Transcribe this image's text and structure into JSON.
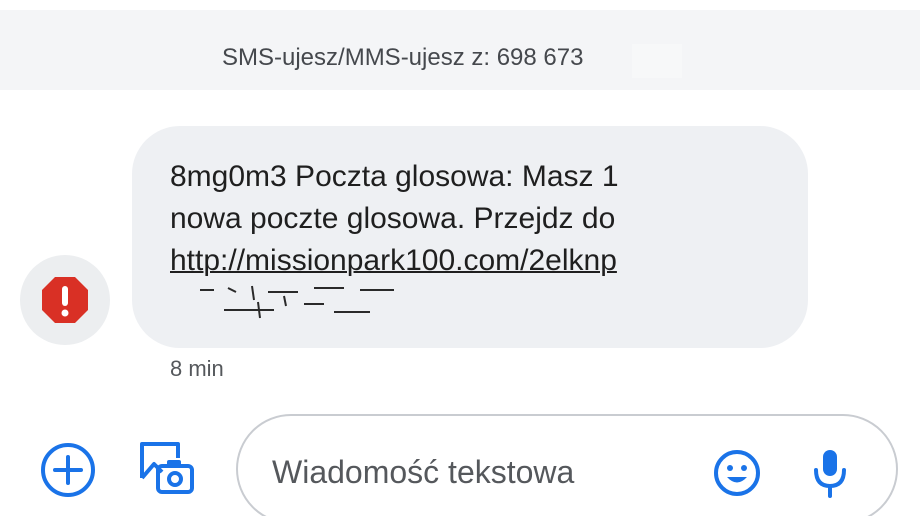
{
  "header": {
    "sender_line": "SMS-ujesz/MMS-ujesz z: 698 673"
  },
  "message": {
    "text": "8mg0m3 Poczta glosowa: Masz 1\nnowa poczte glosowa. Przejdz do",
    "link": "http://missionpark100.com/2elknp",
    "timestamp": "8 min"
  },
  "compose": {
    "placeholder": "Wiadomość tekstowa"
  },
  "colors": {
    "accent": "#1a73e8",
    "alert": "#d93025",
    "bubble": "#eef0f3",
    "banner": "#f4f5f7"
  },
  "icons": {
    "alert": "exclamation-octagon-icon",
    "add": "plus-circle-icon",
    "media": "image-camera-icon",
    "emoji": "smiley-icon",
    "mic": "microphone-icon"
  }
}
